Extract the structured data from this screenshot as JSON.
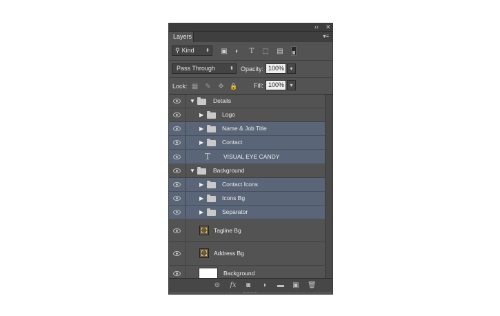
{
  "panel": {
    "tab_label": "Layers",
    "collapse_glyph": "‹‹",
    "close_glyph": "✕",
    "menu_glyph": "▾≡"
  },
  "filter": {
    "search_glyph": "⚲",
    "kind_label": "Kind",
    "icons": [
      "image-filter-icon",
      "adjustment-filter-icon",
      "type-filter-icon",
      "shape-filter-icon",
      "smart-object-filter-icon"
    ],
    "icon_glyphs": [
      "▣",
      "◐",
      "T",
      "⬚",
      "▤"
    ]
  },
  "blending": {
    "mode_label": "Pass Through",
    "opacity_label": "Opacity:",
    "opacity_value": "100%",
    "dropdown_glyph": "▾"
  },
  "lock": {
    "label": "Lock:",
    "icon_glyphs": [
      "▦",
      "✎",
      "✥",
      "🔒"
    ],
    "fill_label": "Fill:",
    "fill_value": "100%"
  },
  "layers": [
    {
      "name": "Details",
      "kind": "group",
      "expanded": true,
      "indent": 0,
      "selected": false,
      "visible": true
    },
    {
      "name": "Logo",
      "kind": "group",
      "expanded": false,
      "indent": 1,
      "selected": false,
      "visible": true
    },
    {
      "name": "Name & Job Title",
      "kind": "group",
      "expanded": false,
      "indent": 1,
      "selected": true,
      "visible": true
    },
    {
      "name": "Contact",
      "kind": "group",
      "expanded": false,
      "indent": 1,
      "selected": true,
      "visible": true
    },
    {
      "name": "VISUAL EYE CANDY",
      "kind": "text",
      "indent": 1,
      "selected": true,
      "visible": true
    },
    {
      "name": "Background",
      "kind": "group",
      "expanded": true,
      "indent": 0,
      "selected": false,
      "visible": true
    },
    {
      "name": "Contact Icons",
      "kind": "group",
      "expanded": false,
      "indent": 1,
      "selected": true,
      "visible": true
    },
    {
      "name": "Icons Bg",
      "kind": "group",
      "expanded": false,
      "indent": 1,
      "selected": true,
      "visible": true
    },
    {
      "name": "Separator",
      "kind": "group",
      "expanded": false,
      "indent": 1,
      "selected": true,
      "visible": true
    },
    {
      "name": "Tagline Bg",
      "kind": "smart",
      "indent": 0,
      "selected": false,
      "visible": true
    },
    {
      "name": "Address Bg",
      "kind": "smart",
      "indent": 0,
      "selected": false,
      "visible": true
    },
    {
      "name": "Background",
      "kind": "fill",
      "indent": 0,
      "selected": false,
      "visible": true
    }
  ],
  "bottom_icons": [
    {
      "name": "link-layers-icon",
      "glyph": "⊝"
    },
    {
      "name": "layer-style-icon",
      "glyph": "fx"
    },
    {
      "name": "add-mask-icon",
      "glyph": "◙"
    },
    {
      "name": "new-adjustment-icon",
      "glyph": "◑"
    },
    {
      "name": "new-group-icon",
      "glyph": "▬"
    },
    {
      "name": "new-layer-icon",
      "glyph": "▣"
    },
    {
      "name": "delete-layer-icon",
      "glyph": "🗑"
    }
  ]
}
